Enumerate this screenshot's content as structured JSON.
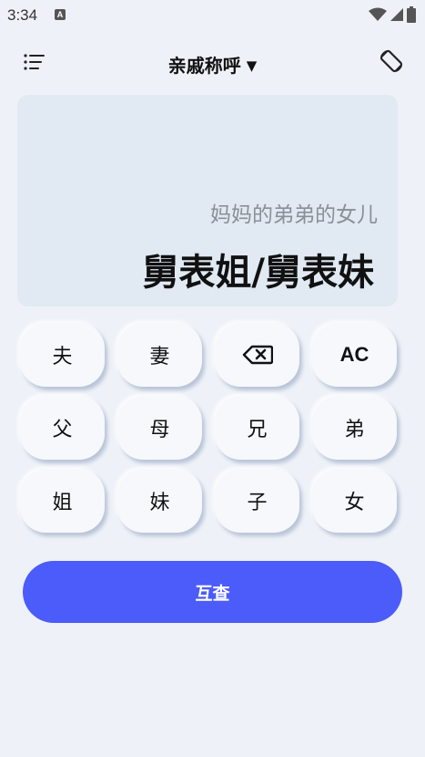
{
  "status_bar": {
    "time": "3:34",
    "notification_icon_letter": "A"
  },
  "app_bar": {
    "title": "亲戚称呼",
    "caret": "▼"
  },
  "display": {
    "expression": "妈妈的弟弟的女儿",
    "result": "舅表姐/舅表妹"
  },
  "keypad": {
    "keys": [
      {
        "label": "夫"
      },
      {
        "label": "妻"
      },
      {
        "label": ""
      },
      {
        "label": "AC"
      },
      {
        "label": "父"
      },
      {
        "label": "母"
      },
      {
        "label": "兄"
      },
      {
        "label": "弟"
      },
      {
        "label": "姐"
      },
      {
        "label": "妹"
      },
      {
        "label": "子"
      },
      {
        "label": "女"
      }
    ]
  },
  "actions": {
    "query_label": "互查"
  },
  "colors": {
    "accent": "#4b5cfa",
    "background": "#eef2f8",
    "display_bg": "#e1e9f3"
  },
  "icons": {
    "menu": "menu-list-icon",
    "rotate": "screen-rotate-icon",
    "backspace": "backspace-icon",
    "wifi": "wifi-icon",
    "signal": "signal-icon",
    "battery": "battery-icon"
  }
}
